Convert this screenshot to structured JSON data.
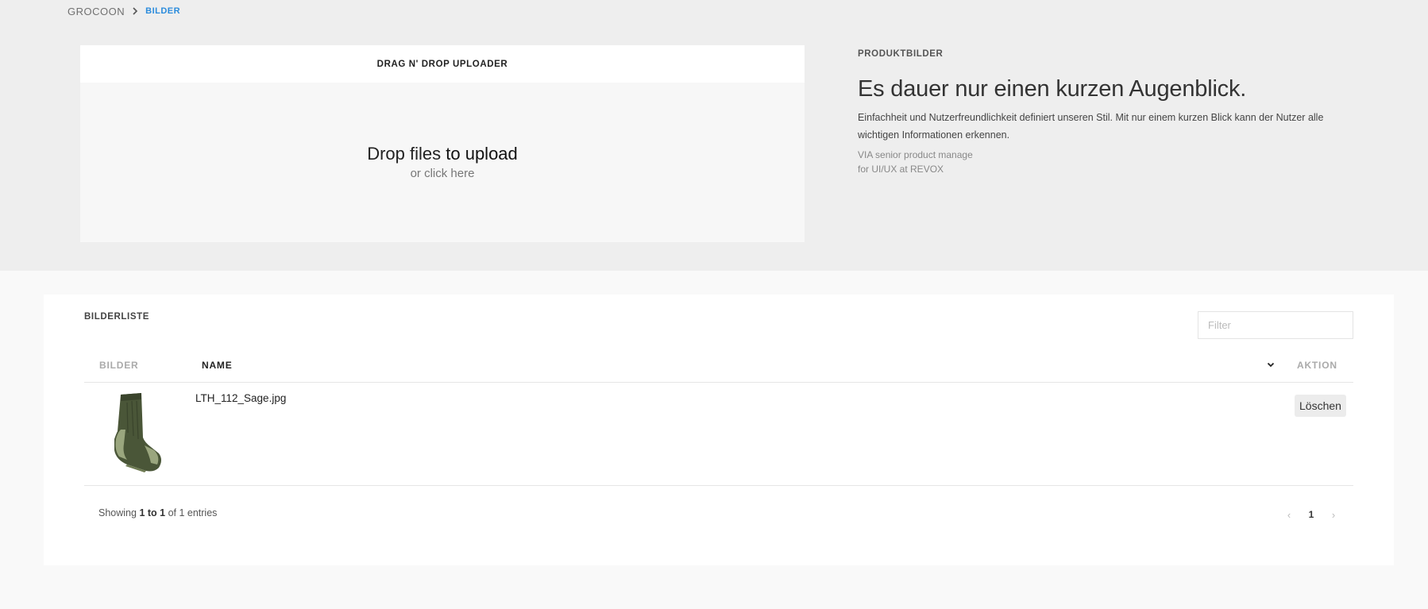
{
  "breadcrumb": {
    "root": "GROCOON",
    "separator": ">",
    "current": "BILDER"
  },
  "uploader": {
    "header": "DRAG N' DROP UPLOADER",
    "drop_text_1": "Drop files ",
    "drop_text_2": "to upload",
    "drop_sub": "or click here"
  },
  "info": {
    "label": "PRODUKTBILDER",
    "title": "Es dauer nur einen kurzen Augenblick.",
    "text": "Einfachheit und Nutzerfreundlichkeit definiert unseren Stil. Mit nur einem kurzen Blick kann der Nutzer alle wichtigen Informationen erkennen.",
    "meta_line_1": "VIA senior product manage",
    "meta_line_2": "for UI/UX at REVOX"
  },
  "list": {
    "title": "BILDERLISTE",
    "filter_placeholder": "Filter",
    "columns": {
      "images": "BILDER",
      "name": "NAME",
      "action": "AKTION"
    },
    "rows": [
      {
        "name": "LTH_112_Sage.jpg",
        "action": "Löschen",
        "image_icon": "sock-thumbnail"
      }
    ]
  },
  "footer": {
    "showing_prefix": "Showing ",
    "showing_range": "1 to 1",
    "showing_of": " of ",
    "showing_total": "1",
    "showing_suffix": " entries"
  },
  "pagination": {
    "prev": "‹",
    "current": "1",
    "next": "›"
  },
  "colors": {
    "accent": "#2a8bdc",
    "top_background": "#eeeeee",
    "page_background": "#f9f9f9"
  }
}
